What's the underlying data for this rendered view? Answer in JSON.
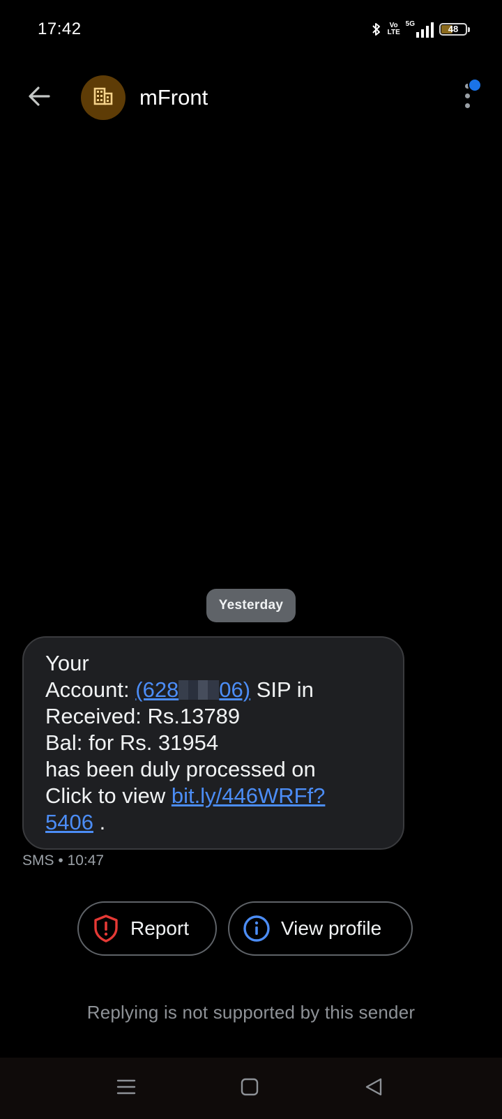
{
  "status_bar": {
    "time": "17:42",
    "network_badge": "Vo LTE",
    "network_type": "5G",
    "battery_level": "48",
    "battery_fraction": 0.48,
    "battery_color": "#8a6a1e"
  },
  "app_bar": {
    "sender_name": "mFront",
    "avatar_icon": "business-building-icon",
    "avatar_color": "#5e3c06",
    "unread_dot_color": "#1a73e8"
  },
  "conversation": {
    "date_chip": "Yesterday",
    "message": {
      "line1": "Your",
      "line2_prefix": "Account: ",
      "account_start": "(628",
      "account_end": "06)",
      "line2_suffix": " SIP in",
      "line3": "Received: Rs.13789",
      "line4": "Bal:  for Rs. 31954",
      "line5": "has been duly processed on",
      "line6_prefix": "Click to view ",
      "link_part1": "bit.ly/446WRFf?",
      "link_part2": "5406",
      "line7_suffix": " .",
      "link_color": "#4c8df6"
    },
    "meta": "SMS • 10:47"
  },
  "actions": {
    "report_label": "Report",
    "report_icon_color": "#e53935",
    "profile_label": "View profile",
    "profile_icon_color": "#4c8df6"
  },
  "reply_notice": "Replying is not supported by this sender"
}
